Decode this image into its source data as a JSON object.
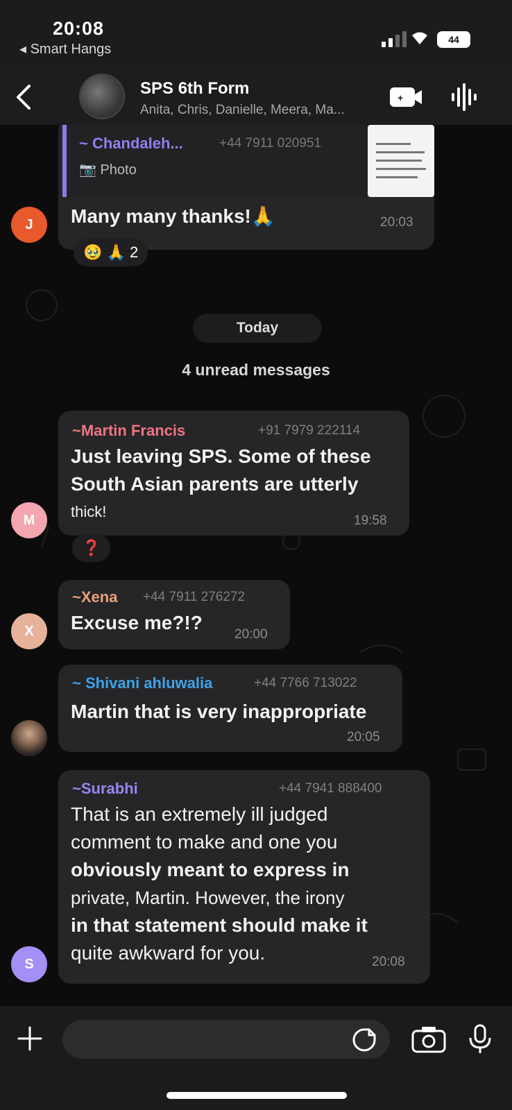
{
  "status_bar": {
    "time": "20:08",
    "back_app": "◂ Smart Hangs",
    "battery": "44"
  },
  "header": {
    "title": "SPS 6th Form",
    "members": "Anita, Chris, Danielle, Meera, Ma..."
  },
  "messages": [
    {
      "reply_to": {
        "name": "~ Chandaleh...",
        "number": "+44 7911 020951",
        "type": "Photo"
      },
      "avatar_letter": "J",
      "avatar_color": "#e85a2b",
      "text": "Many many thanks!🙏",
      "time": "20:03",
      "reactions": "🥹 🙏 2"
    },
    {
      "sender": "~Martin Francis",
      "sender_color": "#ee7682",
      "number": "+91 7979 222114",
      "avatar_letter": "M",
      "avatar_color": "#f3a6ad",
      "text_lines": [
        "Just leaving SPS. Some of these",
        "South Asian parents are utterly",
        "thick!"
      ],
      "time": "19:58",
      "reactions": "❓"
    },
    {
      "sender": "~Xena",
      "sender_color": "#e8a07a",
      "number": "+44 7911 276272",
      "avatar_letter": "X",
      "avatar_color": "#e6b29a",
      "text": "Excuse me?!?",
      "time": "20:00"
    },
    {
      "sender": "~ Shivani ahluwalia",
      "sender_color": "#3fa3e8",
      "number": "+44 7766 713022",
      "text": "Martin that is very inappropriate",
      "time": "20:05"
    },
    {
      "sender": "~Surabhi",
      "sender_color": "#9b85f2",
      "number": "+44 7941 888400",
      "avatar_letter": "S",
      "avatar_color": "#a58ff5",
      "text_lines": [
        "That is an extremely ill judged",
        "comment to make and one you",
        "obviously meant to express in",
        "private, Martin. However, the irony",
        "in that statement should make it",
        "quite  awkward for you."
      ],
      "time": "20:08"
    }
  ],
  "date_separator": "Today",
  "unread_label": "4 unread messages",
  "composer": {
    "placeholder": ""
  }
}
